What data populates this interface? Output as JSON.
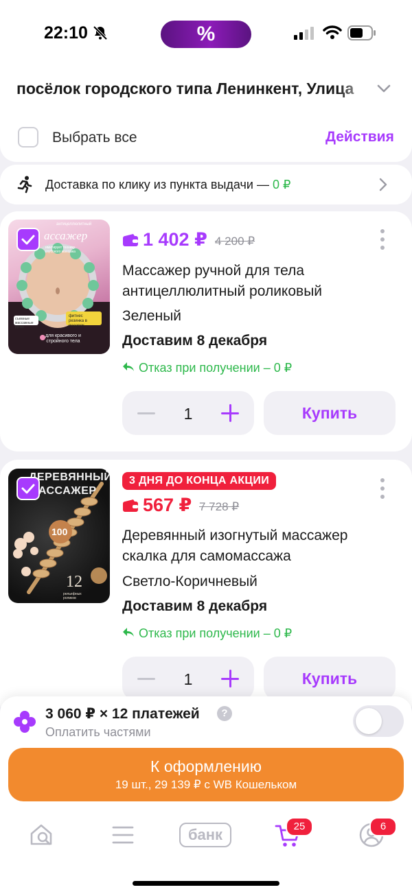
{
  "status_bar": {
    "time": "22:10",
    "promo_pill": "%"
  },
  "address": {
    "text": "посёлок городского типа Ленинкент, Улица"
  },
  "selection": {
    "select_all_label": "Выбрать все",
    "actions_label": "Действия"
  },
  "delivery_banner": {
    "text": "Доставка по клику из пункта выдачи — ",
    "price": "0 ₽"
  },
  "products": [
    {
      "image_alt": "Массажер антицеллюлитный",
      "image_heading": "ассажер",
      "image_tagline": "антицеллюлитный",
      "image_caption": "для красивого и стройного тела",
      "image_badge_left": "съемные массажные ручки",
      "image_badge_right": "фитнес резинка в подарок",
      "image_note": "имитирует технику глубокого массажа",
      "promo": "",
      "price": "1 402 ₽",
      "old_price": "4 200 ₽",
      "price_color": "#a73afd",
      "title": "Массажер ручной для тела антицеллюлитный роликовый",
      "color": "Зеленый",
      "delivery": "Доставим 8 декабря",
      "refund": "Отказ при получении – 0 ₽",
      "quantity": "1",
      "buy_label": "Купить"
    },
    {
      "image_alt": "Деревянный массажер",
      "image_heading_1": "ДЕРЕВЯННЫЙ",
      "image_heading_2": "МАССАЖЕР",
      "image_badge": "100",
      "image_count": "12",
      "image_count_caption": "рельефных роликов",
      "promo": "3 ДНЯ ДО КОНЦА АКЦИИ",
      "price": "567 ₽",
      "old_price": "7 728 ₽",
      "price_color": "#f0203c",
      "title": "Деревянный изогнутый массажер скалка для самомассажа",
      "color": "Светло-Коричневый",
      "delivery": "Доставим 8 декабря",
      "refund": "Отказ при получении – 0 ₽",
      "quantity": "1",
      "buy_label": "Купить"
    }
  ],
  "installments": {
    "main": "3 060 ₽ × 12 платежей",
    "sub": "Оплатить частями",
    "help": "?",
    "toggle_on": false
  },
  "checkout": {
    "title": "К оформлению",
    "subtitle": "19 шт., 29 139 ₽ с WB Кошельком"
  },
  "tabbar": {
    "bank_label": "банк",
    "cart_badge": "25",
    "profile_badge": "6"
  },
  "colors": {
    "accent": "#a73afd",
    "sale_red": "#f0203c",
    "success_green": "#2db84b",
    "checkout_orange": "#f28a2e"
  }
}
